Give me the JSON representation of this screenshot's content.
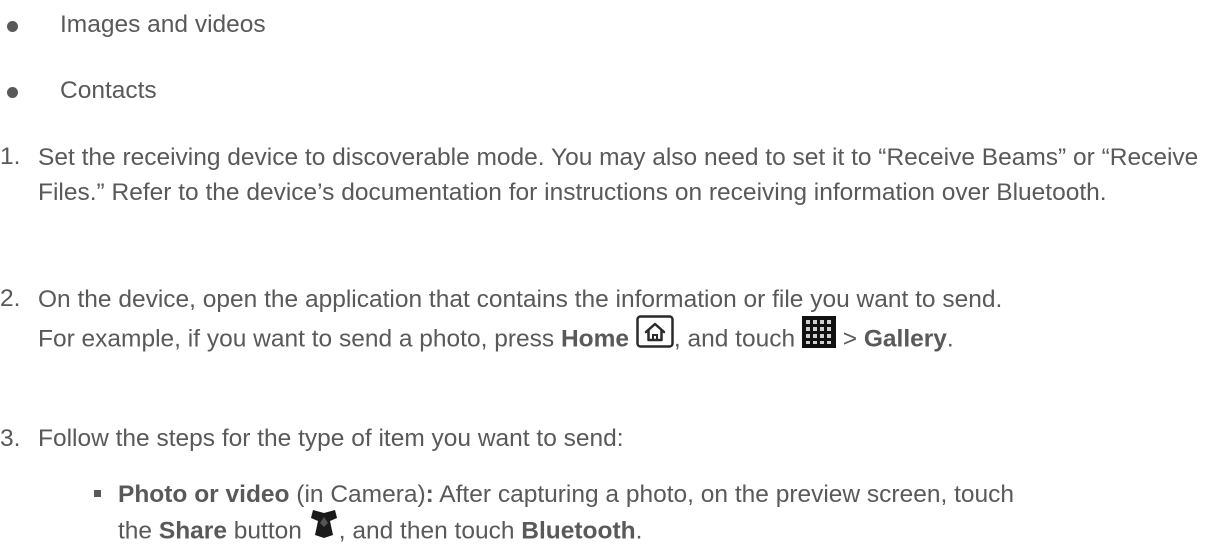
{
  "bullets": [
    {
      "label": "Images and videos"
    },
    {
      "label": "Contacts"
    }
  ],
  "steps": [
    {
      "number": "1.",
      "text": "Set the receiving device to discoverable mode. You may also need to set it to “Receive Beams” or “Receive Files.” Refer to the device’s documentation for instructions on receiving information over Bluetooth."
    },
    {
      "number": "2.",
      "line1": "On the device, open the application that contains the information or file you want to send.",
      "line2_prefix": "For example, if you want to send a photo, press",
      "home_label": "Home",
      "home_icon": "home-key-icon",
      "and_touch": ", and touch",
      "apps_icon": "apps-grid-icon",
      "gt": ">",
      "gallery_label": "Gallery",
      "period": "."
    },
    {
      "number": "3.",
      "text": "Follow the steps for the type of item you want to send:"
    }
  ],
  "substeps": [
    {
      "title": "Photo or video",
      "context": " (in Camera)",
      "colon": ":",
      "line1_rest": " After capturing a photo, on the preview screen, touch",
      "the": "the",
      "share_label": "Share",
      "button_word": " button",
      "share_icon": "share-icon",
      "then_touch": ", and then touch",
      "bluetooth_label": "Bluetooth",
      "period": "."
    }
  ],
  "colors": {
    "text": "#595959",
    "icon_dark": "#1a1a1a",
    "icon_border": "#2a2a2a"
  }
}
